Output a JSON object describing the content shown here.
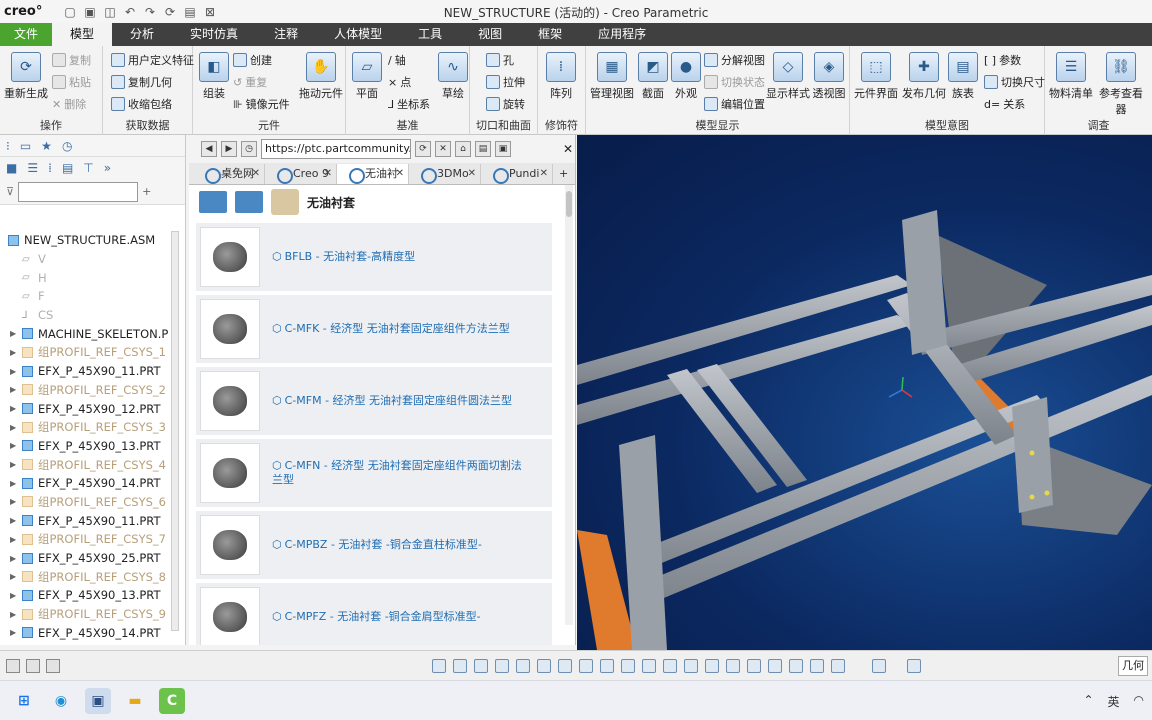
{
  "app": {
    "logo": "creo°",
    "window_title": "NEW_STRUCTURE (活动的) - Creo Parametric"
  },
  "ribbon_tabs": [
    "文件",
    "模型",
    "分析",
    "实时仿真",
    "注释",
    "人体模型",
    "工具",
    "视图",
    "框架",
    "应用程序"
  ],
  "ribbon_groups": {
    "operations": {
      "label": "操作",
      "regenerate": "重新生成",
      "copy": "复制",
      "paste": "粘贴",
      "delete": "删除"
    },
    "get_data": {
      "label": "获取数据",
      "udf": "用户定义特征",
      "copy_geom": "复制几何",
      "shrinkwrap": "收缩包络"
    },
    "component": {
      "label": "元件",
      "assemble": "组装",
      "create": "创建",
      "repeat": "重复",
      "mirror": "镜像元件",
      "drag": "拖动元件"
    },
    "datum": {
      "label": "基准",
      "plane": "平面",
      "axis": "轴",
      "point": "点",
      "csys": "坐标系",
      "sketch": "草绘"
    },
    "cut_surface": {
      "label": "切口和曲面",
      "hole": "孔",
      "extrude": "拉伸",
      "revolve": "旋转"
    },
    "modifiers": {
      "label": "修饰符",
      "pattern": "阵列"
    },
    "model_display": {
      "label": "模型显示",
      "manage_views": "管理视图",
      "section": "截面",
      "appearance": "外观",
      "explode": "分解视图",
      "toggle_status": "切换状态",
      "edit_position": "编辑位置",
      "display_style": "显示样式",
      "perspective": "透视图"
    },
    "model_intent": {
      "label": "模型意图",
      "component_interface": "元件界面",
      "publish_geom": "发布几何",
      "family_table": "族表",
      "params": "参数",
      "switch_dim": "切换尺寸",
      "relations": "关系"
    },
    "investigate": {
      "label": "调查",
      "bom": "物料清单",
      "ref_viewer": "参考查看器"
    }
  },
  "model_tree": {
    "filter_placeholder": "",
    "root": "NEW_STRUCTURE.ASM",
    "items": [
      {
        "label": "V",
        "kind": "datum"
      },
      {
        "label": "H",
        "kind": "datum"
      },
      {
        "label": "F",
        "kind": "datum"
      },
      {
        "label": "CS",
        "kind": "datum"
      },
      {
        "label": "MACHINE_SKELETON.P",
        "kind": "part"
      },
      {
        "label": "组PROFIL_REF_CSYS_1",
        "kind": "csys"
      },
      {
        "label": "EFX_P_45X90_11.PRT",
        "kind": "part"
      },
      {
        "label": "组PROFIL_REF_CSYS_2",
        "kind": "csys"
      },
      {
        "label": "EFX_P_45X90_12.PRT",
        "kind": "part"
      },
      {
        "label": "组PROFIL_REF_CSYS_3",
        "kind": "csys"
      },
      {
        "label": "EFX_P_45X90_13.PRT",
        "kind": "part"
      },
      {
        "label": "组PROFIL_REF_CSYS_4",
        "kind": "csys"
      },
      {
        "label": "EFX_P_45X90_14.PRT",
        "kind": "part"
      },
      {
        "label": "组PROFIL_REF_CSYS_6",
        "kind": "csys"
      },
      {
        "label": "EFX_P_45X90_11.PRT",
        "kind": "part"
      },
      {
        "label": "组PROFIL_REF_CSYS_7",
        "kind": "csys"
      },
      {
        "label": "EFX_P_45X90_25.PRT",
        "kind": "part"
      },
      {
        "label": "组PROFIL_REF_CSYS_8",
        "kind": "csys"
      },
      {
        "label": "EFX_P_45X90_13.PRT",
        "kind": "part"
      },
      {
        "label": "组PROFIL_REF_CSYS_9",
        "kind": "csys"
      },
      {
        "label": "EFX_P_45X90_14.PRT",
        "kind": "part"
      }
    ]
  },
  "browser": {
    "url": "https://ptc.partcommunity.c",
    "tabs": [
      "桌免网",
      "Creo 9",
      "无油衬",
      "3DMo",
      "Pundi"
    ],
    "page_title": "无油衬套",
    "products": [
      "BFLB - 无油衬套-高精度型",
      "C-MFK - 经济型 无油衬套固定座组件方法兰型",
      "C-MFM - 经济型 无油衬套固定座组件圆法兰型",
      "C-MFN - 经济型 无油衬套固定座组件两面切割法兰型",
      "C-MPBZ - 无油衬套 -铜合金直柱标准型-",
      "C-MPFZ - 无油衬套 -铜合金肩型标准型-"
    ]
  },
  "status": {
    "selection_filter": "几何"
  },
  "taskbar": {
    "ime": "英"
  },
  "colors": {
    "tab_file_green": "#4aa42e",
    "ribbon_dark": "#404040",
    "viewport_blue": "#0b2860",
    "link_blue": "#1f6db3"
  }
}
